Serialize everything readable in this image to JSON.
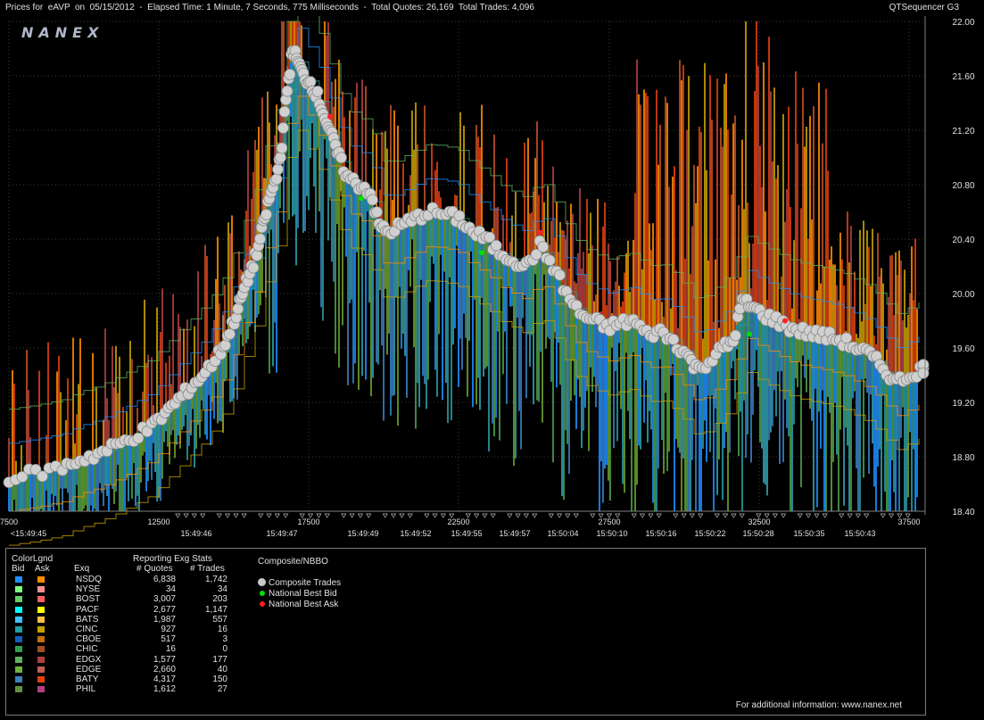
{
  "header": {
    "title_left": "Prices for  eAVP  on  05/15/2012  -  Elapsed Time: 1 Minute, 7 Seconds, 775 Milliseconds  -  Total Quotes: 26,169  Total Trades: 4,096",
    "title_right": "QTSequencer G3"
  },
  "watermark": "NANEX",
  "chart_data": {
    "type": "scatter",
    "title": "Prices for eAVP on 05/15/2012",
    "ylim": [
      18.4,
      22.0
    ],
    "y_ticks": [
      "22.00",
      "21.60",
      "21.20",
      "20.80",
      "20.40",
      "20.00",
      "19.60",
      "19.20",
      "18.80",
      "18.40"
    ],
    "x_seq_ticks": [
      "7500",
      "12500",
      "17500",
      "22500",
      "27500",
      "32500",
      "37500"
    ],
    "x_time_ticks": [
      "<15:49:45",
      "15:49:46",
      "15:49:47",
      "15:49:49",
      "15:49:52",
      "15:49:55",
      "15:49:57",
      "15:50:04",
      "15:50:10",
      "15:50:16",
      "15:50:22",
      "15:50:28",
      "15:50:35",
      "15:50:43"
    ],
    "grid": true,
    "series": [
      {
        "name": "Composite Trades",
        "color": "#c8c8c8",
        "x": [
          0,
          30,
          60,
          80,
          100,
          120,
          140,
          160,
          175,
          190,
          205,
          220,
          235,
          245,
          255,
          262,
          270,
          278,
          285,
          292,
          300,
          306,
          312,
          318,
          324,
          330,
          338,
          346,
          354,
          362,
          370,
          380,
          392,
          405,
          415,
          425,
          440,
          455,
          470,
          490,
          505,
          520,
          535,
          550,
          565,
          580,
          595,
          610,
          625,
          640,
          655,
          670,
          685,
          700,
          715,
          730,
          745,
          760,
          770,
          785,
          800,
          812,
          822,
          832,
          845,
          860,
          875,
          890,
          905,
          920,
          935,
          950,
          965,
          980,
          995,
          1010,
          1025
        ],
        "y": [
          18.65,
          18.68,
          18.72,
          18.78,
          18.82,
          18.88,
          18.95,
          19.02,
          19.12,
          19.22,
          19.32,
          19.42,
          19.55,
          19.68,
          19.85,
          20.0,
          20.15,
          20.3,
          20.5,
          20.7,
          20.85,
          21.1,
          21.5,
          21.8,
          21.7,
          21.6,
          21.55,
          21.45,
          21.3,
          21.15,
          21.0,
          20.85,
          20.8,
          20.75,
          20.5,
          20.45,
          20.5,
          20.55,
          20.6,
          20.58,
          20.55,
          20.45,
          20.4,
          20.3,
          20.25,
          20.2,
          20.35,
          20.2,
          20.0,
          19.85,
          19.8,
          19.75,
          19.78,
          19.8,
          19.7,
          19.72,
          19.65,
          19.55,
          19.45,
          19.5,
          19.6,
          19.65,
          19.95,
          19.9,
          19.85,
          19.8,
          19.75,
          19.72,
          19.7,
          19.68,
          19.65,
          19.6,
          19.55,
          19.45,
          19.35,
          19.4,
          19.45
        ]
      },
      {
        "name": "National Best Bid",
        "color": "#00e000"
      },
      {
        "name": "National Best Ask",
        "color": "#ff2020"
      }
    ]
  },
  "legend": {
    "colorlgnd_label": "ColorLgnd",
    "bid_label": "Bid",
    "ask_label": "Ask",
    "exq_label": "Exq",
    "stats_title": "Reporting Exg Stats",
    "quotes_header": "# Quotes",
    "trades_header": "# Trades",
    "composite_title": "Composite/NBBO",
    "composite_items": [
      {
        "label": "Composite Trades",
        "color": "#c8c8c8"
      },
      {
        "label": "National Best Bid",
        "color": "#00e000"
      },
      {
        "label": "National Best Ask",
        "color": "#ff2020"
      }
    ],
    "exchanges": [
      {
        "name": "NSDQ",
        "quotes": "6,838",
        "trades": "1,742",
        "bid_color": "#1e90ff",
        "ask_color": "#ff8c00"
      },
      {
        "name": "NYSE",
        "quotes": "34",
        "trades": "34",
        "bid_color": "#7fff7f",
        "ask_color": "#ff9090"
      },
      {
        "name": "BOST",
        "quotes": "3,007",
        "trades": "203",
        "bid_color": "#66cc66",
        "ask_color": "#ff6060"
      },
      {
        "name": "PACF",
        "quotes": "2,677",
        "trades": "1,147",
        "bid_color": "#00ffff",
        "ask_color": "#ffff00"
      },
      {
        "name": "BATS",
        "quotes": "1,987",
        "trades": "557",
        "bid_color": "#40c0ff",
        "ask_color": "#ffc040"
      },
      {
        "name": "CINC",
        "quotes": "927",
        "trades": "16",
        "bid_color": "#20a0a0",
        "ask_color": "#c8a000"
      },
      {
        "name": "CBOE",
        "quotes": "517",
        "trades": "3",
        "bid_color": "#1060c0",
        "ask_color": "#c07010"
      },
      {
        "name": "CHIC",
        "quotes": "16",
        "trades": "0",
        "bid_color": "#30a050",
        "ask_color": "#a05020"
      },
      {
        "name": "EDGX",
        "quotes": "1,577",
        "trades": "177",
        "bid_color": "#60b060",
        "ask_color": "#b04040"
      },
      {
        "name": "EDGE",
        "quotes": "2,660",
        "trades": "40",
        "bid_color": "#70b040",
        "ask_color": "#c06050"
      },
      {
        "name": "BATY",
        "quotes": "4,317",
        "trades": "150",
        "bid_color": "#4080c0",
        "ask_color": "#e04010"
      },
      {
        "name": "PHIL",
        "quotes": "1,612",
        "trades": "27",
        "bid_color": "#609040",
        "ask_color": "#b04080"
      }
    ],
    "footer": "For additional information: www.nanex.net"
  }
}
